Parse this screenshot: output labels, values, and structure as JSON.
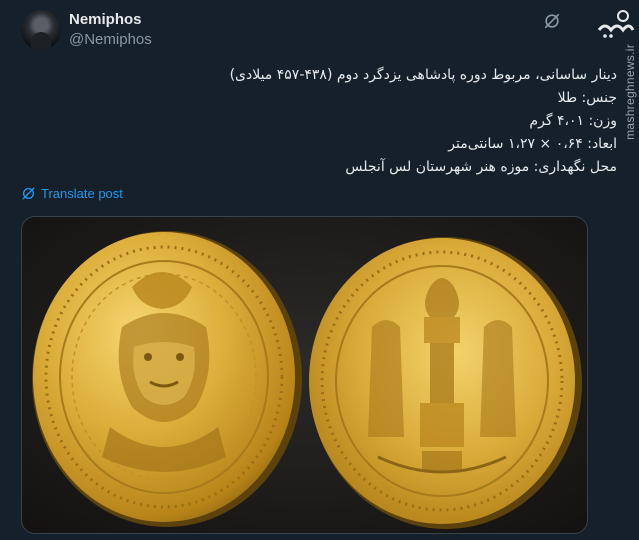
{
  "author": {
    "display_name": "Nemiphos",
    "handle": "@Nemiphos"
  },
  "tweet": {
    "lines": [
      "دینار ساسانی، مربوط دوره پادشاهی یزدگرد دوم (۴۳۸-۴۵۷ میلادی)",
      "جنس: طلا",
      "وزن: ۴،۰۱ گرم",
      "ابعاد: ۰،۶۴ × ۱،۲۷ سانتی‌متر",
      "محل نگهداری: موزه هنر شهرستان لس آنجلس"
    ],
    "translate_label": "Translate post"
  },
  "media": {
    "description_icon": "gold-coin-photo"
  },
  "watermark": {
    "logo_text": "مشرق",
    "site": "mashreghnews.ir"
  },
  "colors": {
    "background": "#15202b",
    "text": "#e7e9ea",
    "muted": "#8b98a5",
    "accent": "#1d9bf0",
    "gold": "#d4a52a"
  }
}
